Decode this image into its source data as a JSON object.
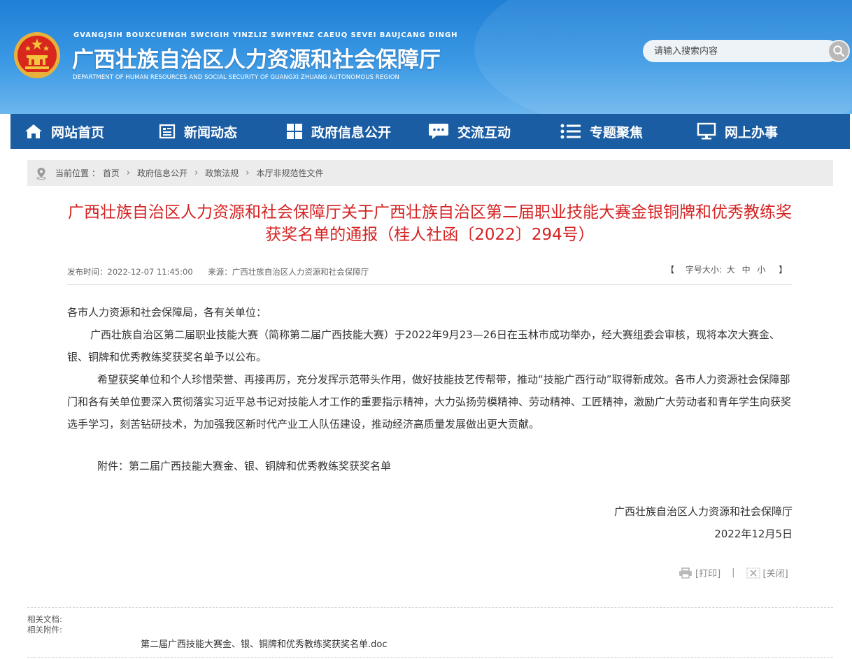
{
  "header": {
    "pinyin": "GVANGJSIH BOUXCUENGH SWCIGIH YINZLIZ SWHYENZ CAEUQ SEVEI BAUJCANG DINGH",
    "title": "广西壮族自治区人力资源和社会保障厅",
    "english": "DEPARTMENT OF HUMAN RESOURCES AND SOCIAL SECURITY OF GUANGXI ZHUANG AUTONOMOUS REGION",
    "search_placeholder": "请输入搜索内容"
  },
  "nav": [
    {
      "label": "网站首页",
      "icon": "home-icon"
    },
    {
      "label": "新闻动态",
      "icon": "news-icon"
    },
    {
      "label": "政府信息公开",
      "icon": "grid-icon"
    },
    {
      "label": "交流互动",
      "icon": "chat-icon"
    },
    {
      "label": "专题聚焦",
      "icon": "list-icon"
    },
    {
      "label": "网上办事",
      "icon": "monitor-icon"
    }
  ],
  "breadcrumb": {
    "prefix": "当前位置 ：",
    "items": [
      "首页",
      "政府信息公开",
      "政策法规",
      "本厅非规范性文件"
    ]
  },
  "article": {
    "title": "广西壮族自治区人力资源和社会保障厅关于广西壮族自治区第二届职业技能大赛金银铜牌和优秀教练奖获奖名单的通报（桂人社函〔2022〕294号）",
    "publish_time": "发布时间：2022-12-07 11:45:00",
    "source": "来源：广西壮族自治区人力资源和社会保障厅",
    "fontsize_label": "字号大小:",
    "fontsize_options": [
      "大",
      "中",
      "小"
    ],
    "bracket_left": "【",
    "bracket_right": "】",
    "salutation": "各市人力资源和社会保障局，各有关单位：",
    "para1": "广西壮族自治区第二届职业技能大赛（简称第二届广西技能大赛）于2022年9月23—26日在玉林市成功举办，经大赛组委会审核，现将本次大赛金、银、铜牌和优秀教练奖获奖名单予以公布。",
    "para2": "希望获奖单位和个人珍惜荣誉、再接再厉，充分发挥示范带头作用，做好技能技艺传帮带，推动“技能广西行动”取得新成效。各市人力资源社会保障部门和各有关单位要深入贯彻落实习近平总书记对技能人才工作的重要指示精神，大力弘扬劳模精神、劳动精神、工匠精神，激励广大劳动者和青年学生向获奖选手学习，刻苦钻研技术，为加强我区新时代产业工人队伍建设，推动经济高质量发展做出更大贡献。",
    "attachment": "附件：第二届广西技能大赛金、银、铜牌和优秀教练奖获奖名单",
    "signature_org": "广西壮族自治区人力资源和社会保障厅",
    "signature_date": "2022年12月5日"
  },
  "tools": {
    "print": "[打印]",
    "close": "[关闭]",
    "separator": "|"
  },
  "related": {
    "docs_label": "相关文档:",
    "attachments_label": "相关附件:",
    "file_name": "第二届广西技能大赛金、银、铜牌和优秀教练奖获奖名单.doc"
  },
  "colors": {
    "header_blue": "#1f7fd6",
    "nav_blue": "#1b5da3",
    "title_red": "#d52323"
  }
}
